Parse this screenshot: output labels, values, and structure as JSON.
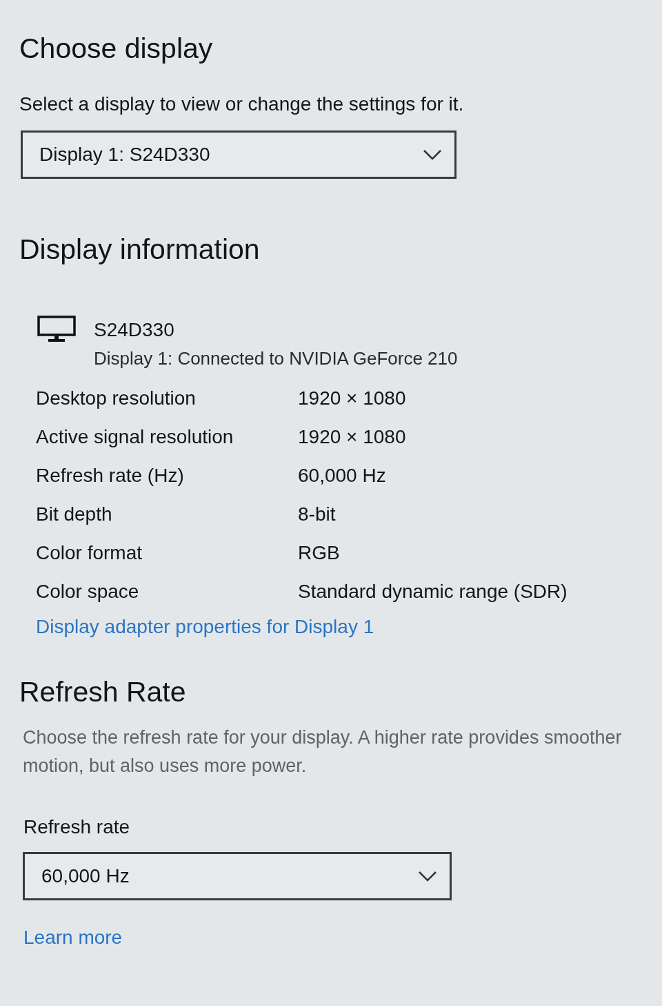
{
  "choose_display": {
    "title": "Choose display",
    "description": "Select a display to view or change the settings for it.",
    "dropdown": {
      "value": "Display 1: S24D330"
    }
  },
  "display_information": {
    "title": "Display information",
    "monitor": {
      "name": "S24D330",
      "subtitle": "Display 1: Connected to NVIDIA GeForce 210"
    },
    "rows": [
      {
        "label": "Desktop resolution",
        "value": "1920 × 1080"
      },
      {
        "label": "Active signal resolution",
        "value": "1920 × 1080"
      },
      {
        "label": "Refresh rate (Hz)",
        "value": "60,000 Hz"
      },
      {
        "label": "Bit depth",
        "value": "8-bit"
      },
      {
        "label": "Color format",
        "value": "RGB"
      },
      {
        "label": "Color space",
        "value": "Standard dynamic range (SDR)"
      }
    ],
    "link": "Display adapter properties for Display 1"
  },
  "refresh_rate": {
    "title": "Refresh Rate",
    "description": "Choose the refresh rate for your display. A higher rate provides smoother motion, but also uses more power.",
    "field_label": "Refresh rate",
    "dropdown": {
      "value": "60,000 Hz"
    },
    "link": "Learn more"
  }
}
